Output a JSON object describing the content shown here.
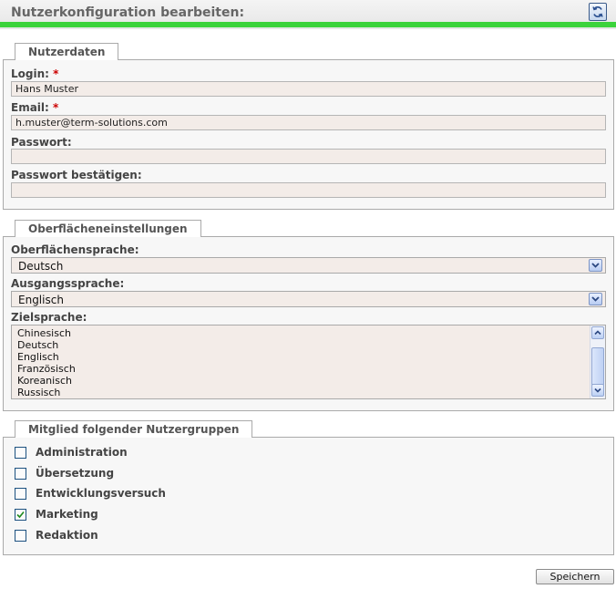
{
  "header": {
    "title": "Nutzerkonfiguration bearbeiten:",
    "accent_color": "#3bd33b",
    "refresh_icon": "refresh-icon"
  },
  "user_data": {
    "tab_label": "Nutzerdaten",
    "login_label": "Login:",
    "login_value": "Hans Muster",
    "email_label": "Email:",
    "email_value": "h.muster@term-solutions.com",
    "password_label": "Passwort:",
    "password_value": "",
    "password_confirm_label": "Passwort bestätigen:",
    "password_confirm_value": "",
    "required_marker": "*"
  },
  "ui_settings": {
    "tab_label": "Oberflächeneinstellungen",
    "interface_language_label": "Oberflächensprache:",
    "interface_language_value": "Deutsch",
    "source_language_label": "Ausgangssprache:",
    "source_language_value": "Englisch",
    "target_language_label": "Zielsprache:",
    "target_language_options": [
      "Chinesisch",
      "Deutsch",
      "Englisch",
      "Französisch",
      "Koreanisch",
      "Russisch"
    ]
  },
  "groups": {
    "tab_label": "Mitglied folgender Nutzergruppen",
    "items": [
      {
        "label": "Administration",
        "checked": false
      },
      {
        "label": "Übersetzung",
        "checked": false
      },
      {
        "label": "Entwicklungsversuch",
        "checked": false
      },
      {
        "label": "Marketing",
        "checked": true
      },
      {
        "label": "Redaktion",
        "checked": false
      }
    ]
  },
  "actions": {
    "save_label": "Speichern"
  }
}
